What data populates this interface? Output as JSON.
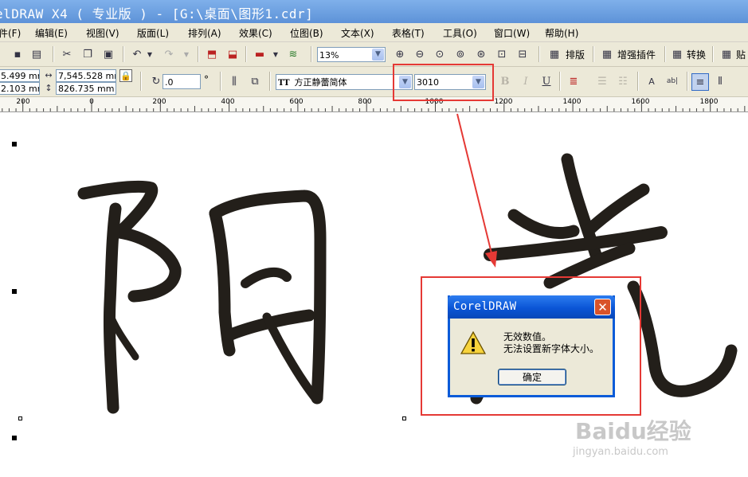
{
  "window": {
    "title": "elDRAW X4 ( 专业版 ) - [G:\\桌面\\图形1.cdr]"
  },
  "menu": [
    "件(F)",
    "编辑(E)",
    "视图(V)",
    "版面(L)",
    "排列(A)",
    "效果(C)",
    "位图(B)",
    "文本(X)",
    "表格(T)",
    "工具(O)",
    "窗口(W)",
    "帮助(H)"
  ],
  "toolbar": {
    "zoom_value": "13%",
    "plugins": {
      "layout": "排版",
      "enhance": "增强插件",
      "convert": "转换",
      "paste": "贴"
    }
  },
  "property_bar": {
    "x": "5.499 mm",
    "y": "2.103 mm",
    "width": "7,545.528 mm",
    "height": "826.735 mm",
    "rotation": ".0",
    "rotation_unit": "°",
    "font_name": "方正静蕾简体",
    "font_size": "3010",
    "font_icon": "TT"
  },
  "ruler": {
    "labels": [
      "200",
      "0",
      "200",
      "400",
      "600",
      "800",
      "1000",
      "1200",
      "1400",
      "1600",
      "1800"
    ]
  },
  "canvas": {
    "text": "阳光"
  },
  "dialog": {
    "title": "CorelDRAW",
    "message_line1": "无效数值。",
    "message_line2": "无法设置新字体大小。",
    "ok_label": "确定",
    "icon": "warning-icon"
  },
  "watermark": {
    "brand": "Baidu经验",
    "url": "jingyan.baidu.com"
  },
  "colors": {
    "highlight": "#e53935",
    "xp_blue": "#0a55d6",
    "glyph": "#231f1a"
  }
}
